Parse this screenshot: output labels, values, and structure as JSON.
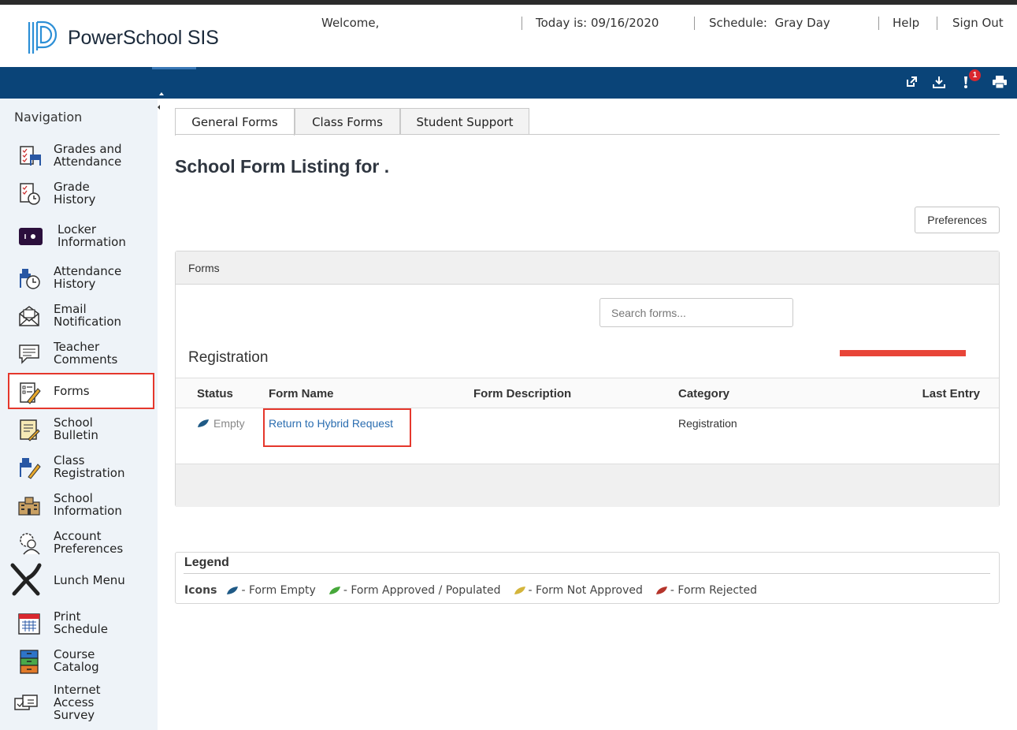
{
  "header": {
    "brand": "PowerSchool SIS",
    "welcome": "Welcome,",
    "today": "Today is: 09/16/2020",
    "schedule": "Schedule:  Gray Day",
    "help": "Help",
    "sign_out": "Sign Out"
  },
  "toolbar": {
    "icons": [
      "external-link-icon",
      "download-icon",
      "notification-icon",
      "print-icon"
    ],
    "notification_count": "1"
  },
  "sidebar": {
    "title": "Navigation",
    "items": [
      {
        "label": "Grades and\nAttendance",
        "icon": "grades-attendance-icon"
      },
      {
        "label": "Grade\nHistory",
        "icon": "grade-history-icon"
      },
      {
        "label": "Locker\nInformation",
        "icon": "locker-icon"
      },
      {
        "label": "Attendance\nHistory",
        "icon": "attendance-history-icon"
      },
      {
        "label": "Email\nNotification",
        "icon": "email-icon"
      },
      {
        "label": "Teacher\nComments",
        "icon": "comments-icon"
      },
      {
        "label": "Forms",
        "icon": "forms-icon",
        "active": true
      },
      {
        "label": "School\nBulletin",
        "icon": "bulletin-icon"
      },
      {
        "label": "Class\nRegistration",
        "icon": "class-registration-icon"
      },
      {
        "label": "School\nInformation",
        "icon": "school-icon"
      },
      {
        "label": "Account\nPreferences",
        "icon": "account-preferences-icon"
      },
      {
        "label": "Lunch Menu",
        "icon": "lunch-icon"
      },
      {
        "label": "Print\nSchedule",
        "icon": "calendar-icon"
      },
      {
        "label": "Course\nCatalog",
        "icon": "catalog-icon"
      },
      {
        "label": "Internet\nAccess\nSurvey",
        "icon": "survey-icon"
      }
    ]
  },
  "tabs": [
    {
      "label": "General Forms",
      "active": true
    },
    {
      "label": "Class Forms"
    },
    {
      "label": "Student Support"
    }
  ],
  "main": {
    "title": "School Form Listing for .",
    "preferences_button": "Preferences",
    "panel_title": "Forms",
    "search_placeholder": "Search forms...",
    "section": "Registration",
    "columns": [
      "Status",
      "Form Name",
      "Form Description",
      "Category",
      "Last Entry"
    ],
    "rows": [
      {
        "status": "Empty",
        "form_name": "Return to Hybrid Request",
        "description": "",
        "category": "Registration",
        "last_entry": ""
      }
    ]
  },
  "legend": {
    "title": "Legend",
    "icons_label": "Icons",
    "items": [
      {
        "label": "- Form Empty",
        "color": "#1f5a86"
      },
      {
        "label": "- Form Approved / Populated",
        "color": "#46a83a"
      },
      {
        "label": "- Form Not Approved",
        "color": "#d4b53c"
      },
      {
        "label": "- Form Rejected",
        "color": "#b5342b"
      }
    ]
  },
  "colors": {
    "brand_bar": "#0a4478",
    "highlight": "#e5372c",
    "link": "#2a6db0"
  }
}
